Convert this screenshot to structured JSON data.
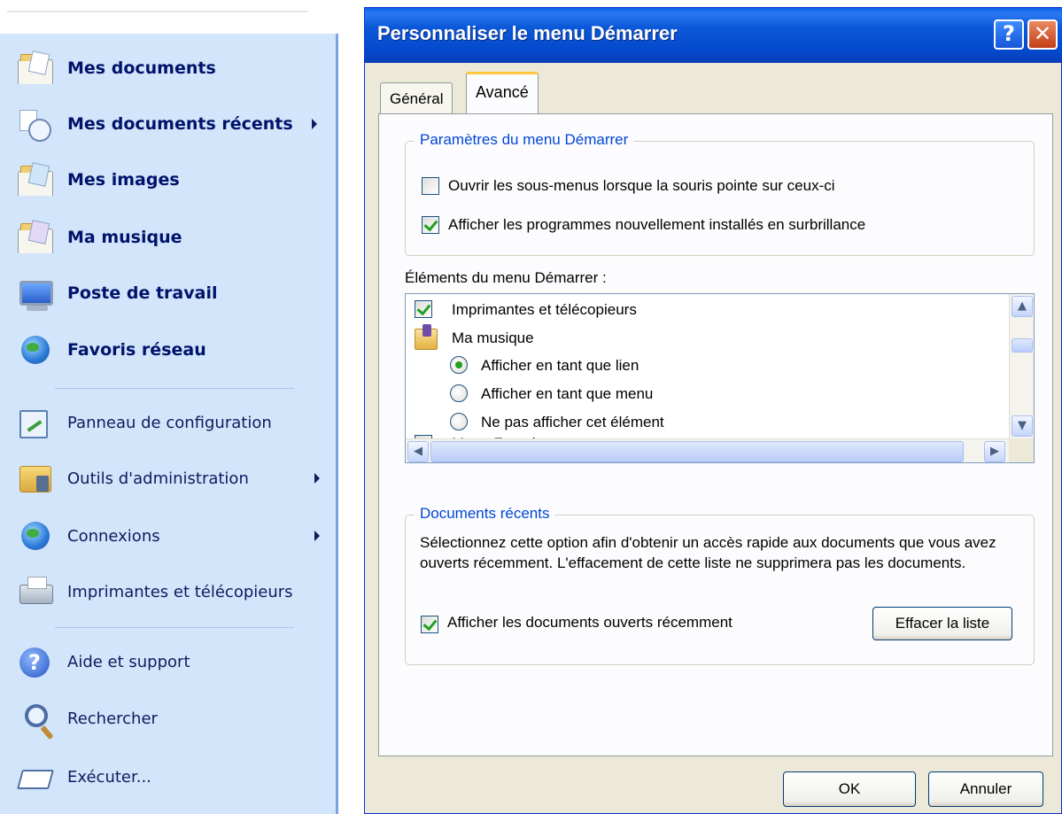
{
  "start_menu": {
    "pinned": [
      {
        "label": "Mes documents"
      },
      {
        "label": "Mes documents récents"
      },
      {
        "label": "Mes images"
      },
      {
        "label": "Ma musique"
      },
      {
        "label": "Poste de travail"
      },
      {
        "label": "Favoris réseau"
      }
    ],
    "system": [
      {
        "label": "Panneau de configuration"
      },
      {
        "label": "Outils d'administration"
      },
      {
        "label": "Connexions"
      },
      {
        "label": "Imprimantes et télécopieurs"
      }
    ],
    "bottom": [
      {
        "label": "Aide et support"
      },
      {
        "label": "Rechercher"
      },
      {
        "label": "Exécuter..."
      }
    ]
  },
  "dialog": {
    "title": "Personnaliser le menu Démarrer",
    "help_glyph": "?",
    "close_glyph": "✕",
    "tabs": [
      {
        "label": "Général",
        "active": false
      },
      {
        "label": "Avancé",
        "active": true
      }
    ],
    "settings_group": {
      "title": "Paramètres du menu Démarrer",
      "options": [
        {
          "label": "Ouvrir les sous-menus lorsque la souris pointe sur ceux-ci",
          "checked": false
        },
        {
          "label": "Afficher les programmes nouvellement installés en surbrillance",
          "checked": true
        }
      ]
    },
    "items_list": {
      "heading": "Éléments du menu Démarrer :",
      "printers": {
        "label": "Imprimantes et télécopieurs",
        "checked": true
      },
      "music": {
        "label": "Ma musique"
      },
      "music_options": [
        {
          "label": "Afficher en tant que lien",
          "selected": true
        },
        {
          "label": "Afficher en tant que menu",
          "selected": false
        },
        {
          "label": "Ne pas afficher cet élément",
          "selected": false
        }
      ],
      "next_item": {
        "label": "Menu Favoris"
      }
    },
    "recent_group": {
      "title": "Documents récents",
      "description": "Sélectionnez cette option afin d'obtenir un accès rapide aux documents que vous avez ouverts récemment. L'effacement de cette liste ne supprimera pas les documents.",
      "checkbox_label": "Afficher les documents ouverts récemment",
      "checked": true,
      "clear_button": "Effacer la liste"
    },
    "ok_button": "OK",
    "cancel_button": "Annuler"
  }
}
